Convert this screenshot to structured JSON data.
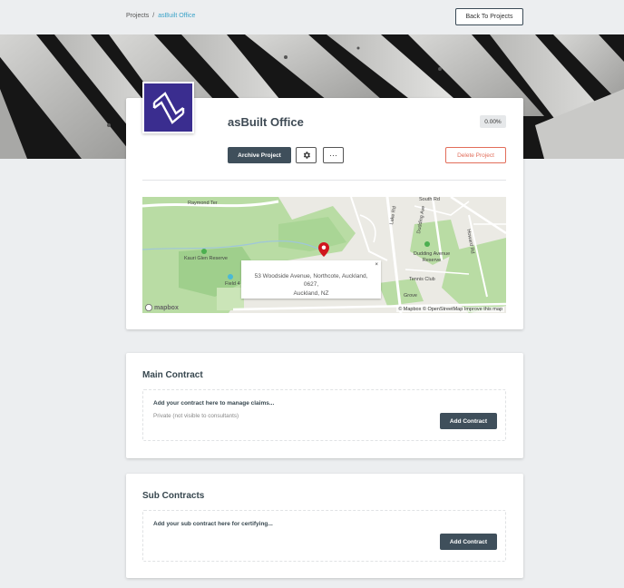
{
  "breadcrumb": {
    "root": "Projects",
    "separator": "/",
    "current": "asBuilt Office"
  },
  "header": {
    "back_label": "Back To Projects"
  },
  "project": {
    "title": "asBuilt Office",
    "progress_label": "0.00%",
    "logo_icon": "asbuilt-logo",
    "logo_color": "#3a2d8f",
    "archive_label": "Archive Project",
    "settings_icon": "gear-icon",
    "more_label": "···",
    "delete_label": "Delete Project",
    "delete_color": "#e26d5a"
  },
  "map": {
    "address_line1": "53 Woodside Avenue, Northcote, Auckland, 0627,",
    "address_line2": "Auckland, NZ",
    "close_label": "×",
    "attribution": "© Mapbox © OpenStreetMap Improve this map",
    "logo_text": "mapbox",
    "labels": {
      "raymond": "Raymond Ter",
      "kauri": "Kauri Glen Reserve",
      "field": "Field 4",
      "lake": "Lake Rd",
      "dudding_ave": "Dudding Ave",
      "dudding_reserve": "Dudding Avenue Reserve",
      "tennis": "Tennis Club",
      "grove": "Grove",
      "south": "South Rd",
      "howard": "Howard Rd"
    }
  },
  "main_contract": {
    "heading": "Main Contract",
    "prompt": "Add your contract here to manage claims...",
    "privacy_note": "Private (not visible to consultants)",
    "button_label": "Add Contract"
  },
  "sub_contracts": {
    "heading": "Sub Contracts",
    "prompt": "Add your sub contract here for certifying...",
    "button_label": "Add Contract"
  },
  "colors": {
    "primary_dark": "#3f4f5b",
    "link": "#3ba3c9",
    "background": "#eceef0"
  }
}
